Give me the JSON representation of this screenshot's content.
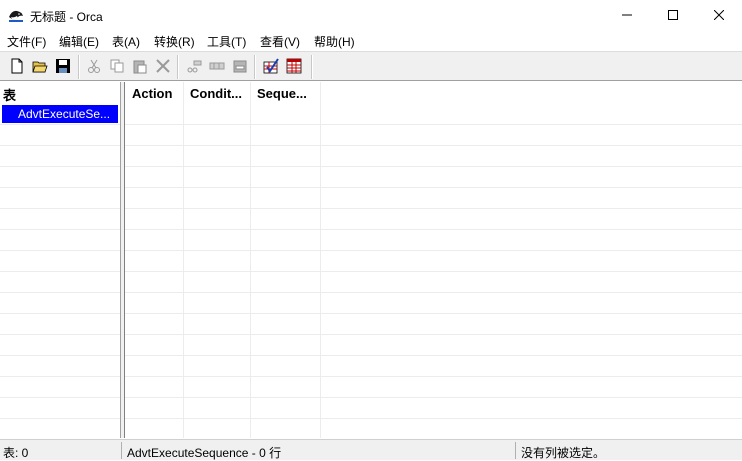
{
  "window": {
    "title": "无标题 - Orca",
    "icon": "orca-app-icon",
    "controls": [
      "minimize-icon",
      "maximize-icon",
      "close-icon"
    ]
  },
  "menu": [
    "文件(F)",
    "编辑(E)",
    "表(A)",
    "转换(R)",
    "工具(T)",
    "查看(V)",
    "帮助(H)"
  ],
  "toolbar": {
    "buttons": [
      {
        "name": "new-icon",
        "enabled": true
      },
      {
        "name": "open-icon",
        "enabled": true
      },
      {
        "name": "save-icon",
        "enabled": true
      },
      {
        "name": "cut-icon",
        "enabled": false
      },
      {
        "name": "copy-icon",
        "enabled": false
      },
      {
        "name": "paste-icon",
        "enabled": false
      },
      {
        "name": "delete-icon",
        "enabled": false
      },
      {
        "name": "cut-row-icon",
        "enabled": false
      },
      {
        "name": "copy-row-icon",
        "enabled": false
      },
      {
        "name": "paste-row-icon",
        "enabled": false
      },
      {
        "name": "validate-icon",
        "enabled": true
      },
      {
        "name": "tables-icon",
        "enabled": true
      }
    ]
  },
  "tables_pane": {
    "header": "表",
    "items": [
      "AdvtExecuteSe..."
    ],
    "selected_index": 0
  },
  "grid": {
    "columns": [
      "Action",
      "Condit...",
      "Seque..."
    ],
    "rows": []
  },
  "status": {
    "tables": "表: 0",
    "current": "AdvtExecuteSequence - 0 行",
    "selection": "没有列被选定。"
  },
  "colors": {
    "selection": "#0000ff",
    "grid_line": "#ececec"
  }
}
